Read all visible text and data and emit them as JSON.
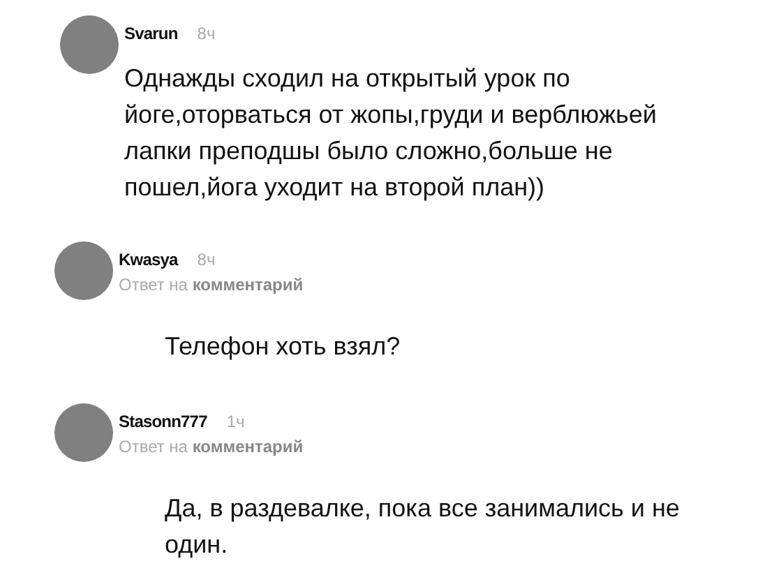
{
  "comments": [
    {
      "kind": "comment",
      "author": "Svarun",
      "time": "8ч",
      "text": "Однажды сходил на открытый урок по йоге,оторваться от жопы,груди и верблюжьей лапки преподшы было сложно,больше не пошел,йога уходит на второй план))"
    },
    {
      "kind": "reply",
      "author": "Kwasya",
      "time": "8ч",
      "reply_to": "Ответ на **комментарий**",
      "text": "Телефон хоть взял?"
    },
    {
      "kind": "reply",
      "author": "Stasonn777",
      "time": "1ч",
      "reply_to": "Ответ на **комментарий**",
      "text": "Да, в раздевалке, пока все занимались и не один."
    }
  ]
}
